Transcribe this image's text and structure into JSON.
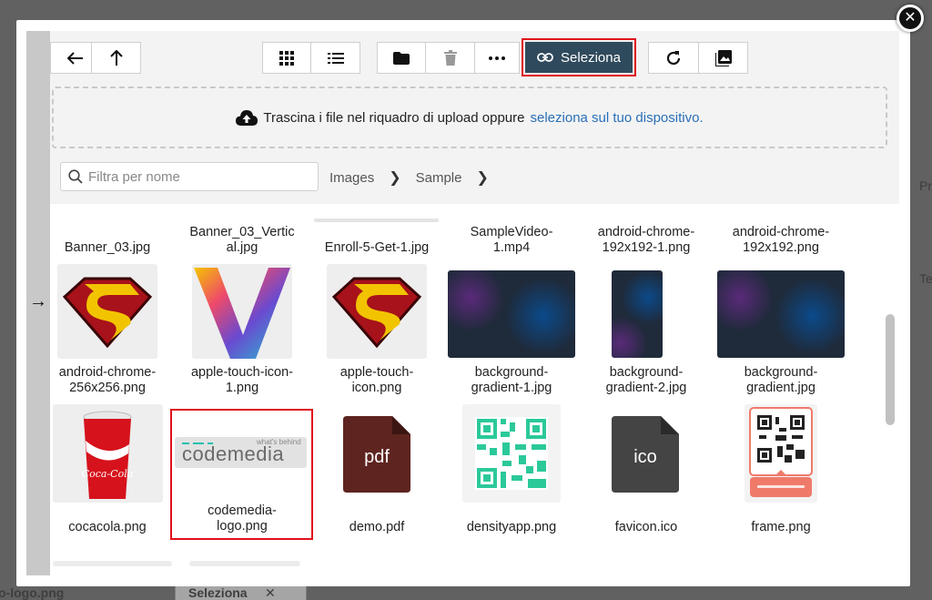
{
  "background": {
    "bottom_text": "o-logo.png",
    "bottom_button": "Seleziona",
    "right_label_1": "Pr",
    "right_label_2": "Te"
  },
  "modal": {
    "close_label": "✕",
    "toolbar": {
      "select_label": "Seleziona"
    },
    "dropzone": {
      "text": "Trascina i file nel riquadro di upload oppure",
      "link": "seleziona sul tuo dispositivo."
    },
    "filter": {
      "placeholder": "Filtra per nome"
    },
    "breadcrumb": [
      "Images",
      "Sample"
    ],
    "files_row1": [
      "Banner_03.jpg",
      "Banner_03_Vertical.jpg",
      "Enroll-5-Get-1.jpg",
      "SampleVideo-1.mp4",
      "android-chrome-192x192-1.png",
      "android-chrome-192x192.png"
    ],
    "files_row2": [
      "android-chrome-256x256.png",
      "apple-touch-icon-1.png",
      "apple-touch-icon.png",
      "background-gradient-1.jpg",
      "background-gradient-2.jpg",
      "background-gradient.jpg"
    ],
    "files_row3": [
      "cocacola.png",
      "codemedia-logo.png",
      "demo.pdf",
      "densityapp.png",
      "favicon.ico",
      "frame.png"
    ],
    "icon_labels": {
      "pdf": "pdf",
      "ico": "ico",
      "coca_cola": "Coca-Cola",
      "codemedia_tagline": "what's behind",
      "codemedia_word": "codemedia"
    },
    "colors": {
      "select_button": "#2f4a5c",
      "selection_border": "#e0101a",
      "link": "#2a6fb8",
      "pdf_icon": "#5e2420",
      "ico_icon": "#444444"
    }
  }
}
